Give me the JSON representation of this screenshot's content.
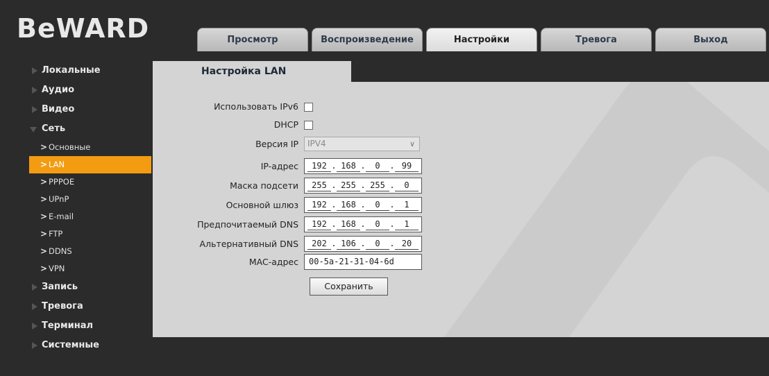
{
  "brand": {
    "logo_text": "BeWARD"
  },
  "tabs": [
    {
      "label": "Просмотр"
    },
    {
      "label": "Воспроизведение"
    },
    {
      "label": "Настройки"
    },
    {
      "label": "Тревога"
    },
    {
      "label": "Выход"
    }
  ],
  "sidebar": {
    "items": [
      {
        "label": "Локальные"
      },
      {
        "label": "Аудио"
      },
      {
        "label": "Видео"
      },
      {
        "label": "Сеть"
      }
    ],
    "subitems": [
      {
        "label": "Основные"
      },
      {
        "label": "LAN"
      },
      {
        "label": "PPPOE"
      },
      {
        "label": "UPnP"
      },
      {
        "label": "E-mail"
      },
      {
        "label": "FTP"
      },
      {
        "label": "DDNS"
      },
      {
        "label": "VPN"
      }
    ],
    "items_after": [
      {
        "label": "Запись"
      },
      {
        "label": "Тревога"
      },
      {
        "label": "Терминал"
      },
      {
        "label": "Системные"
      }
    ]
  },
  "panel": {
    "title": "Настройка LAN",
    "ipv6_label": "Использовать IPv6",
    "dhcp_label": "DHCP",
    "ipver_label": "Версия IP",
    "ipver_value": "IPV4",
    "ip_label": "IP-адрес",
    "ip": [
      "192",
      "168",
      "0",
      "99"
    ],
    "mask_label": "Маска подсети",
    "mask": [
      "255",
      "255",
      "255",
      "0"
    ],
    "gw_label": "Основной шлюз",
    "gw": [
      "192",
      "168",
      "0",
      "1"
    ],
    "dns1_label": "Предпочитаемый DNS",
    "dns1": [
      "192",
      "168",
      "0",
      "1"
    ],
    "dns2_label": "Альтернативный DNS",
    "dns2": [
      "202",
      "106",
      "0",
      "20"
    ],
    "mac_label": "MAC-адрес",
    "mac": "00-5a-21-31-04-6d",
    "save_label": "Сохранить"
  },
  "colors": {
    "accent": "#f39c12",
    "background": "#2b2b2b",
    "panel": "#d4d4d4"
  }
}
